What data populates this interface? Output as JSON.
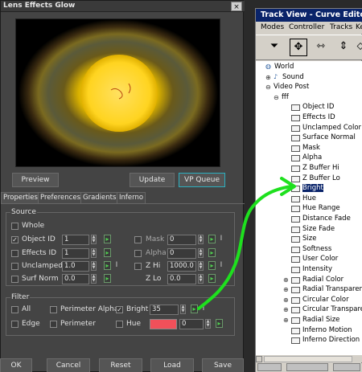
{
  "lens_panel": {
    "title": "Lens Effects Glow",
    "close_glyph": "×",
    "buttons": {
      "preview": "Preview",
      "update": "Update",
      "vp_queue": "VP Queue"
    },
    "tabs": [
      "Properties",
      "Preferences",
      "Gradients",
      "Inferno"
    ],
    "source": {
      "label": "Source",
      "whole": "Whole",
      "object_id": {
        "label": "Object ID",
        "checked": true,
        "value": "1"
      },
      "effects_id": {
        "label": "Effects ID",
        "value": "1"
      },
      "unclamped": {
        "label": "Unclamped",
        "value": "1.0"
      },
      "surf_norm": {
        "label": "Surf Norm",
        "value": "0.0"
      },
      "mask": {
        "label": "Mask",
        "value": "0"
      },
      "alpha": {
        "label": "Alpha",
        "value": "0"
      },
      "z_hi": {
        "label": "Z Hi",
        "value": "1000.0"
      },
      "z_lo": {
        "label": "Z Lo",
        "value": "0.0"
      }
    },
    "filter": {
      "label": "Filter",
      "all": "All",
      "edge": "Edge",
      "perimeter_alpha": "Perimeter Alpha",
      "perimeter": "Perimeter",
      "bright": {
        "label": "Bright",
        "checked": true,
        "value": "35"
      },
      "hue": {
        "label": "Hue",
        "value": "0",
        "swatch_color": "#f0505a"
      }
    },
    "bottom_buttons": [
      "OK",
      "Cancel",
      "Reset",
      "Load",
      "Save"
    ]
  },
  "track_view": {
    "title": "Track View - Curve Editor",
    "menu": [
      "Modes",
      "Controller",
      "Tracks",
      "Key"
    ],
    "tree": [
      {
        "label": "World",
        "level": 0,
        "exp": "",
        "icon": "globe",
        "sel": false
      },
      {
        "label": "Sound",
        "level": 1,
        "exp": "+",
        "icon": "sound",
        "sel": false
      },
      {
        "label": "Video Post",
        "level": 1,
        "exp": "-",
        "icon": "none",
        "sel": false
      },
      {
        "label": "fff",
        "level": 2,
        "exp": "-",
        "icon": "none",
        "sel": false
      },
      {
        "label": "Object ID",
        "level": 3,
        "exp": "",
        "icon": "curve",
        "sel": false
      },
      {
        "label": "Effects ID",
        "level": 3,
        "exp": "",
        "icon": "curve",
        "sel": false
      },
      {
        "label": "Unclamped Color",
        "level": 3,
        "exp": "",
        "icon": "curve",
        "sel": false
      },
      {
        "label": "Surface Normal",
        "level": 3,
        "exp": "",
        "icon": "curve",
        "sel": false
      },
      {
        "label": "Mask",
        "level": 3,
        "exp": "",
        "icon": "curve",
        "sel": false
      },
      {
        "label": "Alpha",
        "level": 3,
        "exp": "",
        "icon": "curve",
        "sel": false
      },
      {
        "label": "Z Buffer Hi",
        "level": 3,
        "exp": "",
        "icon": "curve",
        "sel": false
      },
      {
        "label": "Z Buffer Lo",
        "level": 3,
        "exp": "",
        "icon": "curve",
        "sel": false
      },
      {
        "label": "Bright",
        "level": 3,
        "exp": "",
        "icon": "curve",
        "sel": true
      },
      {
        "label": "Hue",
        "level": 3,
        "exp": "",
        "icon": "curve",
        "sel": false
      },
      {
        "label": "Hue Range",
        "level": 3,
        "exp": "",
        "icon": "curve",
        "sel": false
      },
      {
        "label": "Distance Fade",
        "level": 3,
        "exp": "",
        "icon": "curve",
        "sel": false
      },
      {
        "label": "Size Fade",
        "level": 3,
        "exp": "",
        "icon": "curve",
        "sel": false
      },
      {
        "label": "Size",
        "level": 3,
        "exp": "",
        "icon": "curve",
        "sel": false
      },
      {
        "label": "Softness",
        "level": 3,
        "exp": "",
        "icon": "curve",
        "sel": false
      },
      {
        "label": "User Color",
        "level": 3,
        "exp": "",
        "icon": "curve",
        "sel": false
      },
      {
        "label": "Intensity",
        "level": 3,
        "exp": "",
        "icon": "curve",
        "sel": false
      },
      {
        "label": "Radial Color",
        "level": 3,
        "exp": "+",
        "icon": "curve",
        "sel": false
      },
      {
        "label": "Radial Transparency",
        "level": 3,
        "exp": "+",
        "icon": "curve",
        "sel": false
      },
      {
        "label": "Circular Color",
        "level": 3,
        "exp": "+",
        "icon": "curve",
        "sel": false
      },
      {
        "label": "Circular Transparency",
        "level": 3,
        "exp": "+",
        "icon": "curve",
        "sel": false
      },
      {
        "label": "Radial Size",
        "level": 3,
        "exp": "+",
        "icon": "curve",
        "sel": false
      },
      {
        "label": "Inferno Motion",
        "level": 3,
        "exp": "",
        "icon": "curve",
        "sel": false
      },
      {
        "label": "Inferno Direction",
        "level": 3,
        "exp": "",
        "icon": "curve",
        "sel": false
      }
    ]
  },
  "colors": {
    "annotation_arrow": "#1ee01e",
    "selection": "#0a246a",
    "titlebar": "#0a246a"
  }
}
